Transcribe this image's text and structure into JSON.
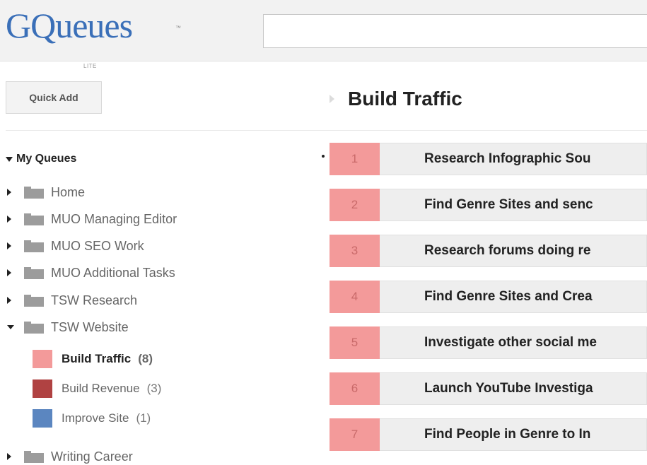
{
  "header": {
    "logo_text": "GQueues",
    "logo_tm": "™",
    "logo_sub": "LITE",
    "search_value": "",
    "search_placeholder": ""
  },
  "toolbar": {
    "quick_add_label": "Quick Add"
  },
  "main": {
    "title": "Build Traffic"
  },
  "sidebar": {
    "heading": "My Queues",
    "folders_top": [
      {
        "label": "Home"
      },
      {
        "label": "MUO Managing Editor"
      },
      {
        "label": "MUO SEO Work"
      },
      {
        "label": "MUO Additional Tasks"
      },
      {
        "label": "TSW Research"
      },
      {
        "label": "TSW Website"
      }
    ],
    "queues": [
      {
        "label": "Build Traffic",
        "count": "(8)",
        "color": "#f39a9a"
      },
      {
        "label": "Build Revenue",
        "count": "(3)",
        "color": "#b04242"
      },
      {
        "label": "Improve Site",
        "count": "(1)",
        "color": "#5b86c0"
      }
    ],
    "folders_bottom": [
      {
        "label": "Writing Career"
      }
    ]
  },
  "tasks": [
    {
      "num": "1",
      "text": "Research Infographic Sou"
    },
    {
      "num": "2",
      "text": "Find Genre Sites and senc"
    },
    {
      "num": "3",
      "text": "Research forums doing re"
    },
    {
      "num": "4",
      "text": "Find Genre Sites and Crea"
    },
    {
      "num": "5",
      "text": "Investigate other social me"
    },
    {
      "num": "6",
      "text": "Launch YouTube Investiga"
    },
    {
      "num": "7",
      "text": "Find People in Genre to In"
    }
  ],
  "colors": {
    "brand": "#3a6fb8",
    "task_number_bg": "#f39a9a",
    "task_row_bg": "#eeeeee"
  }
}
